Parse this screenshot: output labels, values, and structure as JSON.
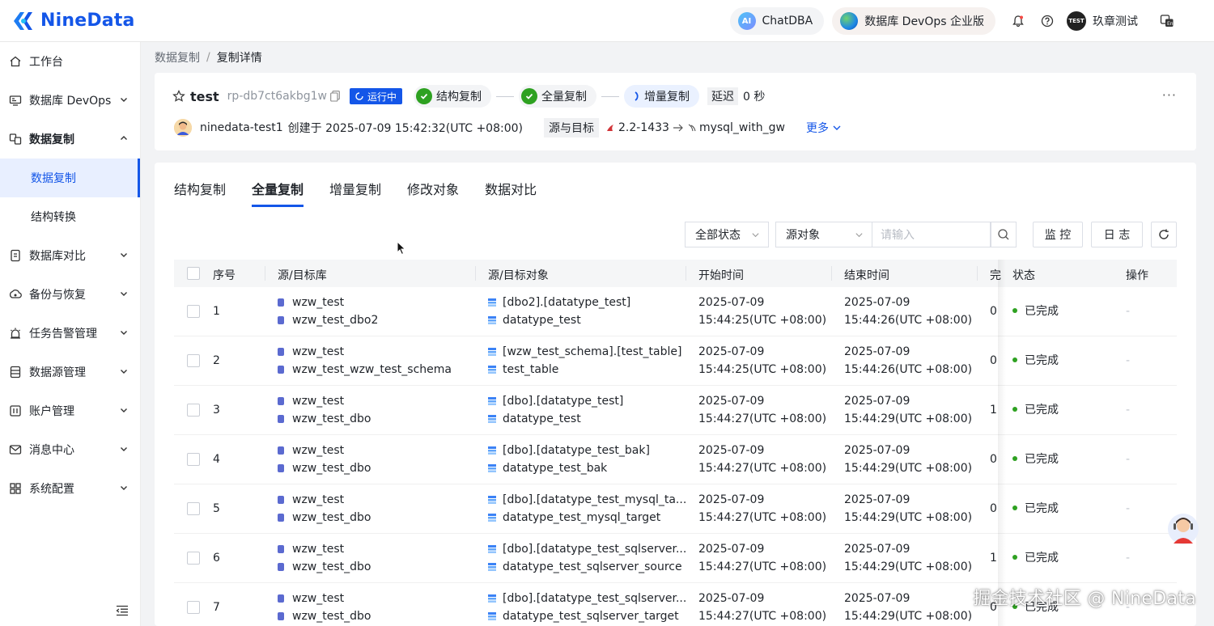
{
  "brand": {
    "name": "NineData",
    "color": "#1456e8"
  },
  "topbar": {
    "chatdba_label": "ChatDBA",
    "devops_label": "数据库 DevOps 企业版",
    "user_name": "玖章测试",
    "user_avatar_text": "TEST"
  },
  "sidebar": {
    "items": [
      {
        "label": "工作台",
        "icon": "home-icon"
      },
      {
        "label": "数据库 DevOps",
        "icon": "monitor-icon"
      },
      {
        "label": "数据复制",
        "icon": "replication-icon"
      },
      {
        "label": "数据复制"
      },
      {
        "label": "结构转换"
      },
      {
        "label": "数据库对比",
        "icon": "compare-icon"
      },
      {
        "label": "备份与恢复",
        "icon": "backup-icon"
      },
      {
        "label": "任务告警管理",
        "icon": "alarm-icon"
      },
      {
        "label": "数据源管理",
        "icon": "datasource-icon"
      },
      {
        "label": "账户管理",
        "icon": "account-icon"
      },
      {
        "label": "消息中心",
        "icon": "message-icon"
      },
      {
        "label": "系统配置",
        "icon": "settings-grid-icon"
      }
    ]
  },
  "breadcrumb": {
    "parent": "数据复制",
    "separator": "/",
    "current": "复制详情"
  },
  "job": {
    "title": "test",
    "id": "rp-db7ct6akbg1w",
    "status": "运行中",
    "stages": [
      "结构复制",
      "全量复制",
      "增量复制"
    ],
    "delay_label": "延迟",
    "delay_value": "0 秒",
    "creator": "ninedata-test1",
    "created_text": "创建于 2025-07-09 15:42:32(UTC +08:00)",
    "src_target_label": "源与目标",
    "source": "2.2-1433",
    "target": "mysql_with_gw",
    "more_label": "更多"
  },
  "tabs": [
    "结构复制",
    "全量复制",
    "增量复制",
    "修改对象",
    "数据对比"
  ],
  "filters": {
    "status_select": "全部状态",
    "object_select": "源对象",
    "search_placeholder": "请输入",
    "monitor_button": "监 控",
    "log_button": "日 志"
  },
  "table": {
    "columns": [
      "序号",
      "源/目标库",
      "源/目标对象",
      "开始时间",
      "结束时间",
      "完",
      "状态",
      "操作"
    ],
    "rows": [
      {
        "no": "1",
        "src_db": "wzw_test",
        "dst_db": "wzw_test_dbo2",
        "src_obj": "[dbo2].[datatype_test]",
        "dst_obj": "datatype_test",
        "start_date": "2025-07-09",
        "start_time": "15:44:25(UTC +08:00)",
        "end_date": "2025-07-09",
        "end_time": "15:44:26(UTC +08:00)",
        "done": "0",
        "status": "已完成",
        "action": "-"
      },
      {
        "no": "2",
        "src_db": "wzw_test",
        "dst_db": "wzw_test_wzw_test_schema",
        "src_obj": "[wzw_test_schema].[test_table]",
        "dst_obj": "test_table",
        "start_date": "2025-07-09",
        "start_time": "15:44:25(UTC +08:00)",
        "end_date": "2025-07-09",
        "end_time": "15:44:26(UTC +08:00)",
        "done": "0",
        "status": "已完成",
        "action": "-"
      },
      {
        "no": "3",
        "src_db": "wzw_test",
        "dst_db": "wzw_test_dbo",
        "src_obj": "[dbo].[datatype_test]",
        "dst_obj": "datatype_test",
        "start_date": "2025-07-09",
        "start_time": "15:44:27(UTC +08:00)",
        "end_date": "2025-07-09",
        "end_time": "15:44:29(UTC +08:00)",
        "done": "1",
        "status": "已完成",
        "action": "-"
      },
      {
        "no": "4",
        "src_db": "wzw_test",
        "dst_db": "wzw_test_dbo",
        "src_obj": "[dbo].[datatype_test_bak]",
        "dst_obj": "datatype_test_bak",
        "start_date": "2025-07-09",
        "start_time": "15:44:27(UTC +08:00)",
        "end_date": "2025-07-09",
        "end_time": "15:44:29(UTC +08:00)",
        "done": "0",
        "status": "已完成",
        "action": "-"
      },
      {
        "no": "5",
        "src_db": "wzw_test",
        "dst_db": "wzw_test_dbo",
        "src_obj": "[dbo].[datatype_test_mysql_ta...",
        "dst_obj": "datatype_test_mysql_target",
        "start_date": "2025-07-09",
        "start_time": "15:44:27(UTC +08:00)",
        "end_date": "2025-07-09",
        "end_time": "15:44:29(UTC +08:00)",
        "done": "0",
        "status": "已完成",
        "action": "-"
      },
      {
        "no": "6",
        "src_db": "wzw_test",
        "dst_db": "wzw_test_dbo",
        "src_obj": "[dbo].[datatype_test_sqlserver...",
        "dst_obj": "datatype_test_sqlserver_source",
        "start_date": "2025-07-09",
        "start_time": "15:44:27(UTC +08:00)",
        "end_date": "2025-07-09",
        "end_time": "15:44:29(UTC +08:00)",
        "done": "1",
        "status": "已完成",
        "action": "-"
      },
      {
        "no": "7",
        "src_db": "wzw_test",
        "dst_db": "wzw_test_dbo",
        "src_obj": "[dbo].[datatype_test_sqlserver...",
        "dst_obj": "datatype_test_sqlserver_target",
        "start_date": "2025-07-09",
        "start_time": "15:44:27(UTC +08:00)",
        "end_date": "2025-07-09",
        "end_time": "15:44:29(UTC +08:00)",
        "done": "0",
        "status": "已完成",
        "action": "-"
      }
    ]
  },
  "watermark": "掘金技术社区 @ NineData"
}
